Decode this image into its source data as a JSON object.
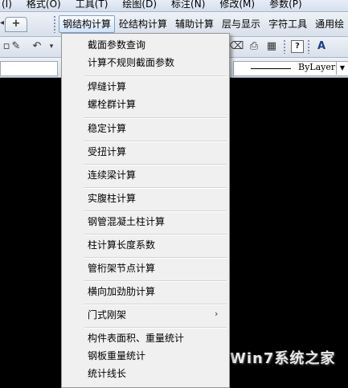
{
  "menubar": {
    "items": [
      "(I)",
      "格式(O)",
      "工具(T)",
      "绘图(D)",
      "标注(N)",
      "修改(M)",
      "参数(P)"
    ]
  },
  "tabs": {
    "new_tab": "+"
  },
  "command_tabs": [
    "钢结构计算",
    "砼结构计算",
    "辅助计算",
    "层与显示",
    "字符工具",
    "通用绘"
  ],
  "toolbar": {
    "help_icon": "question-icon",
    "linetype_label": "ByLayer"
  },
  "dropdown": {
    "items": [
      "截面参数查询",
      "计算不规则截面参数",
      "焊缝计算",
      "螺栓群计算",
      "稳定计算",
      "受扭计算",
      "连续梁计算",
      "实腹柱计算",
      "钢管混凝土柱计算",
      "柱计算长度系数",
      "管桁架节点计算",
      "横向加劲肋计算",
      "门式刚架",
      "构件表面积、重量统计",
      "钢板重量统计",
      "统计线长"
    ],
    "submenu_arrow": "›"
  },
  "watermark": {
    "text": "Win7系统之家"
  },
  "colors": {
    "canvas": "#000000",
    "menu_bg": "#f0f0f0",
    "active_tab": "#cfe3fb"
  }
}
